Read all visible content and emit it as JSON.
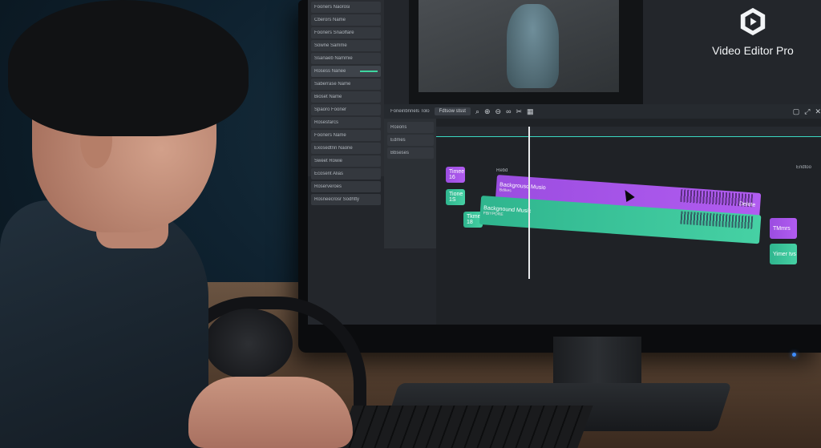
{
  "app": {
    "name": "Video Editor Pro"
  },
  "sidebar": {
    "items": [
      {
        "label": "Fooners Naorosi"
      },
      {
        "label": "Cberors Name"
      },
      {
        "label": "Fooners Snaoffare"
      },
      {
        "label": "Sowne Samme"
      },
      {
        "label": "Ssanaeb Nammie"
      },
      {
        "label": "Rosess Nanee",
        "selected": true
      },
      {
        "label": "Saberrase Name"
      },
      {
        "label": "Bioset Name"
      },
      {
        "label": "Spaoro Fooner"
      },
      {
        "label": "Rosesfarcs"
      },
      {
        "label": "Fooners Name"
      },
      {
        "label": "Exosedtnn Naone"
      },
      {
        "label": "Sweet Rowie"
      },
      {
        "label": "Ecosent Alias"
      },
      {
        "label": "Roserveroes"
      },
      {
        "label": "Rosneecrosr Sodhtty"
      }
    ]
  },
  "panel2": {
    "items": [
      "Rceons",
      "Edmes",
      "Bbseses"
    ]
  },
  "toolbar": {
    "tab": "Foneinbnnels Tolo",
    "button": "Fdtsow stsst",
    "icons": [
      "search-icon",
      "zoom-in-icon",
      "zoom-out-icon",
      "link-icon",
      "scissors-icon",
      "calendar-icon"
    ],
    "right_icons": [
      "square-icon",
      "expand-icon",
      "close-icon"
    ]
  },
  "timeline": {
    "clip_label_top": "Rebd",
    "clips_purple": [
      {
        "label": "Backgrousd Musio",
        "sub": "Bdikes"
      },
      {
        "label": "Timee 16",
        "sub": ""
      },
      {
        "label": "TMmrs",
        "sub": ""
      }
    ],
    "clips_green": [
      {
        "label": "Backgnound Music",
        "sub": "FBIYPDRE"
      },
      {
        "label": "Tione 1S",
        "sub": ""
      },
      {
        "label": "Tkme 18",
        "sub": ""
      },
      {
        "label": "Yimer tvs",
        "sub": ""
      }
    ],
    "delete_label": "Delete",
    "end_label": "Endtoo"
  },
  "colors": {
    "accent_purple": "#b15cf0",
    "accent_green": "#46d1a4",
    "timeline_bg": "#1f2226",
    "ui_bg": "#23262b"
  }
}
